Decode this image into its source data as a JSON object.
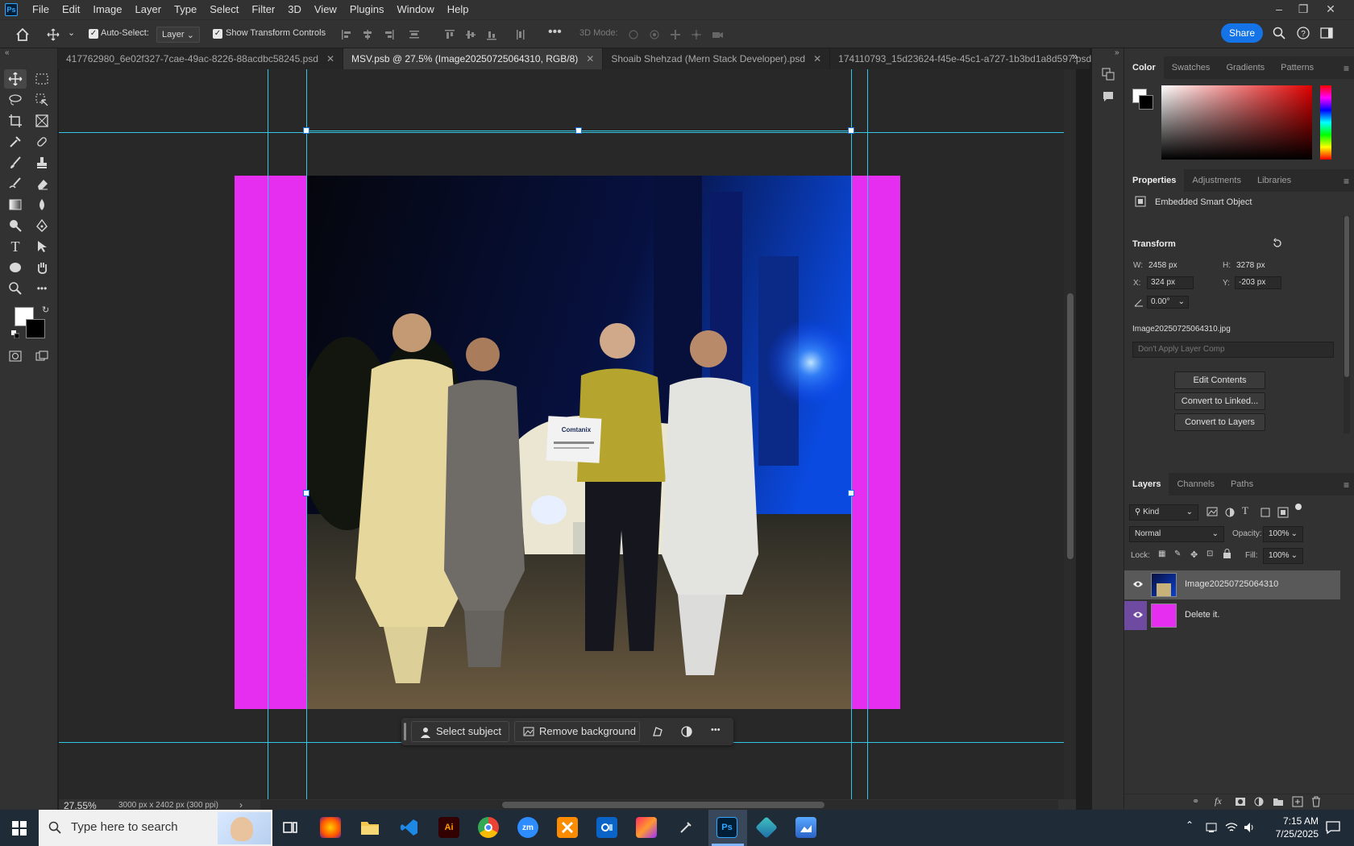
{
  "menubar": {
    "logo": "Ps",
    "items": [
      "File",
      "Edit",
      "Image",
      "Layer",
      "Type",
      "Select",
      "Filter",
      "3D",
      "View",
      "Plugins",
      "Window",
      "Help"
    ],
    "window_controls": [
      "–",
      "❐",
      "✕"
    ]
  },
  "options": {
    "auto_select_label": "Auto-Select:",
    "auto_select_checked": true,
    "auto_select_target": "Layer",
    "show_transform_label": "Show Transform Controls",
    "show_transform_checked": true,
    "mode_3d_label": "3D Mode:",
    "share_label": "Share"
  },
  "tabs": [
    {
      "label": "417762980_6e02f327-7cae-49ac-8226-88acdbc58245.psd",
      "close": "✕",
      "active": false
    },
    {
      "label": "MSV.psb @ 27.5% (Image20250725064310, RGB/8)",
      "close": "✕",
      "active": true
    },
    {
      "label": "Shoaib Shehzad (Mern Stack Developer).psd",
      "close": "✕",
      "active": false
    },
    {
      "label": "174110793_15d23624-f45e-45c1-a727-1b3bd1a8d597.psd",
      "close": "✕",
      "active": false
    }
  ],
  "tabs_overflow": "»",
  "canvas": {
    "sign_text": "Comtanix",
    "artboard_color": "#e62ef0",
    "guide_color": "#35c8e6"
  },
  "contextual_bar": {
    "select_subject": "Select subject",
    "remove_background": "Remove background",
    "more": "•••"
  },
  "status": {
    "zoom": "27.55%",
    "doc_info": "3000 px x 2402 px (300 ppi)",
    "arrow": "›"
  },
  "color_panel": {
    "tabs": [
      "Color",
      "Swatches",
      "Gradients",
      "Patterns"
    ]
  },
  "properties_panel": {
    "tabs": [
      "Properties",
      "Adjustments",
      "Libraries"
    ],
    "object_type": "Embedded Smart Object",
    "transform_title": "Transform",
    "w_label": "W:",
    "w_value": "2458 px",
    "h_label": "H:",
    "h_value": "3278 px",
    "x_label": "X:",
    "x_value": "324 px",
    "y_label": "Y:",
    "y_value": "-203 px",
    "angle_value": "0.00°",
    "filename": "Image20250725064310.jpg",
    "layer_comp": "Don't Apply Layer Comp",
    "buttons": [
      "Edit Contents",
      "Convert to Linked...",
      "Convert to Layers"
    ]
  },
  "layers_panel": {
    "tabs": [
      "Layers",
      "Channels",
      "Paths"
    ],
    "filter_kind": "Kind",
    "blend_mode": "Normal",
    "opacity_label": "Opacity:",
    "opacity_value": "100%",
    "lock_label": "Lock:",
    "fill_label": "Fill:",
    "fill_value": "100%",
    "layers": [
      {
        "name": "Image20250725064310",
        "selected": true
      },
      {
        "name": "Delete it.",
        "selected": false
      }
    ]
  },
  "taskbar": {
    "search_placeholder": "Type here to search",
    "time": "7:15 AM",
    "date": "7/25/2025",
    "apps": [
      "Ai",
      "zm",
      "Ps"
    ]
  }
}
